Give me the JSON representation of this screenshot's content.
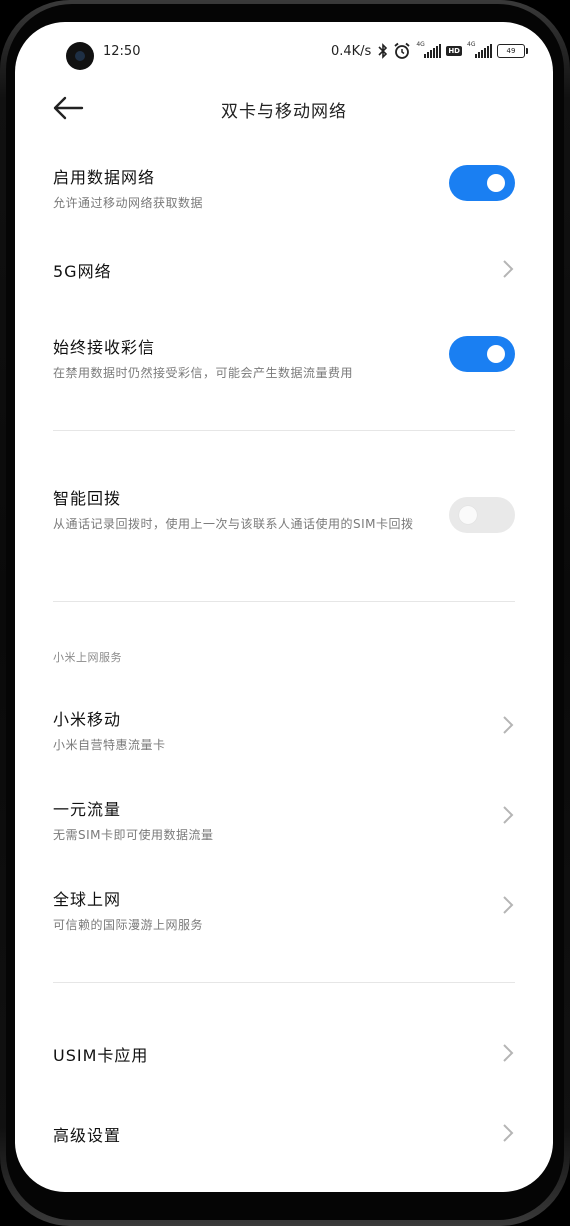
{
  "status": {
    "time": "12:50",
    "speed": "0.4K/s",
    "sig1_tag": "4G",
    "sig2_tag": "4G",
    "hd": "HD",
    "battery": "49"
  },
  "header": {
    "title": "双卡与移动网络"
  },
  "rows": {
    "data_network": {
      "title": "启用数据网络",
      "subtitle": "允许通过移动网络获取数据",
      "enabled": true
    },
    "five_g": {
      "title": "5G网络"
    },
    "mms": {
      "title": "始终接收彩信",
      "subtitle": "在禁用数据时仍然接受彩信，可能会产生数据流量费用",
      "enabled": true
    },
    "smart_callback": {
      "title": "智能回拨",
      "subtitle": "从通话记录回拨时，使用上一次与该联系人通话使用的SIM卡回拨",
      "enabled": false
    },
    "section_label": "小米上网服务",
    "mi_mobile": {
      "title": "小米移动",
      "subtitle": "小米自营特惠流量卡"
    },
    "one_yuan": {
      "title": "一元流量",
      "subtitle": "无需SIM卡即可使用数据流量"
    },
    "global": {
      "title": "全球上网",
      "subtitle": "可信赖的国际漫游上网服务"
    },
    "usim": {
      "title": "USIM卡应用"
    },
    "advanced": {
      "title": "高级设置"
    }
  },
  "colors": {
    "accent": "#1a7ff2",
    "toggle_off": "#e9e9e9"
  }
}
